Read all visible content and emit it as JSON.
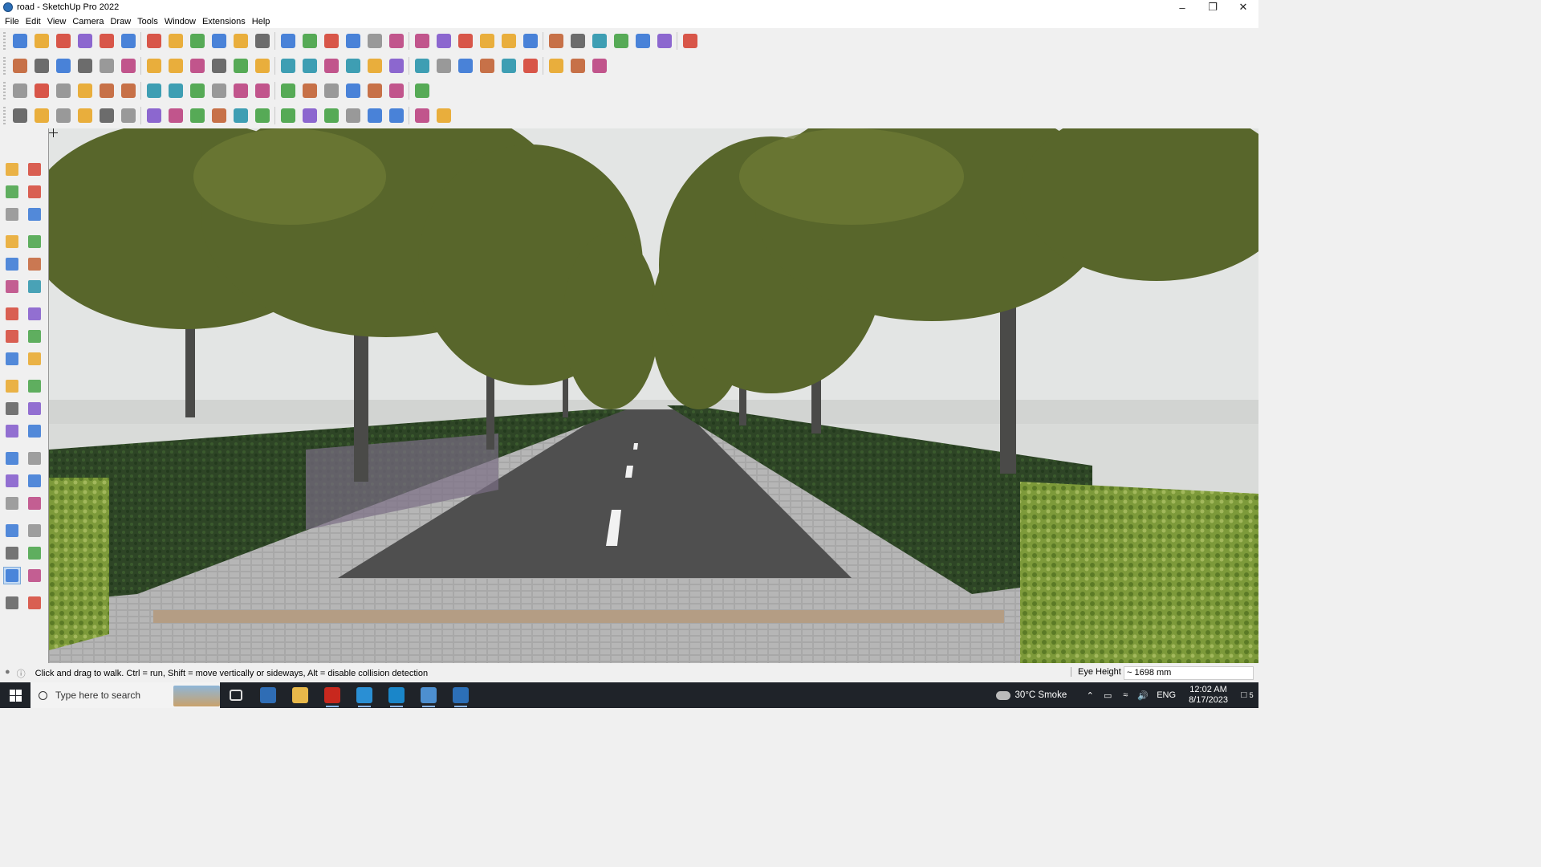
{
  "window": {
    "title": "road - SketchUp Pro 2022",
    "controls": [
      "minimize",
      "restore",
      "close"
    ]
  },
  "menu": [
    "File",
    "Edit",
    "View",
    "Camera",
    "Draw",
    "Tools",
    "Window",
    "Extensions",
    "Help"
  ],
  "toolbars": {
    "row1": [
      "zoom-extents-icon",
      "select-icon",
      "eraser-icon",
      "pencil-line-icon",
      "arc-icon",
      "rectangle-icon",
      "push-pull-icon",
      "follow-me-icon",
      "move-icon",
      "rotate-icon",
      "scale-icon",
      "tape-measure-icon",
      "text-icon",
      "paint-bucket-icon",
      "orbit-icon",
      "pan-icon",
      "zoom-icon",
      "zoom-window-icon",
      "section-plane-icon",
      "display-section-icon",
      "layers-icon",
      "styles-icon",
      "components-icon",
      "warehouse-icon",
      "extension-warehouse-icon",
      "sandbox-icon",
      "drape-icon",
      "flip-icon",
      "intersect-icon",
      "undo-icon",
      "redo-icon"
    ],
    "row2": [
      "iso-view-icon",
      "top-view-icon",
      "front-view-icon",
      "solid-tools-icon",
      "union-icon",
      "subtract-icon",
      "trim-icon",
      "split-icon",
      "outer-shell-icon",
      "intersect-solid-icon",
      "offset-icon",
      "xray-icon",
      "back-edges-icon",
      "wireframe-icon",
      "house-icon",
      "roof-icon",
      "wall-icon",
      "door-icon",
      "window-icon",
      "shape-icon",
      "curve-icon",
      "bezier-icon",
      "polygon-icon",
      "ellipse-icon",
      "arc-tools-icon",
      "spline-icon",
      "fillet-icon"
    ],
    "row3": [
      "face-icon",
      "plane-icon",
      "component-icon",
      "active-component-icon",
      "group-icon",
      "red-cube-icon",
      "chamfer-icon",
      "grid-icon",
      "mesh-icon",
      "profile-icon",
      "curve-select-icon",
      "weld-icon",
      "explode-icon",
      "scale-tool-icon",
      "array-icon",
      "mirror-icon",
      "align-icon",
      "cut-icon",
      "fill-icon"
    ],
    "row4": [
      "line-tool-icon",
      "bezier-tool-icon",
      "material-icon",
      "shape-bender-icon",
      "fredo-scale-icon",
      "joint-push-pull-icon",
      "round-corner-icon",
      "curviloft-icon",
      "skin-icon",
      "extrude-icon",
      "lathe-icon",
      "loft-icon",
      "twist-icon",
      "taper-icon",
      "bend-icon",
      "shear-icon",
      "stretch-icon",
      "spiral-icon",
      "helix-icon",
      "ribbon-icon"
    ]
  },
  "left_toolbar": [
    "select-icon",
    "orbit-icon",
    "paint-bucket-icon",
    "eraser-icon",
    "component-icon",
    "pencil-icon",
    "line-icon",
    "freehand-icon",
    "rectangle-icon",
    "rotated-rectangle-icon",
    "circle-icon",
    "polygon-icon",
    "arc-icon",
    "pie-icon",
    "push-pull-icon",
    "move-icon",
    "rotate-icon",
    "follow-me-icon",
    "scale-icon",
    "offset-icon",
    "tape-measure-icon",
    "dimension-icon",
    "protractor-icon",
    "text-icon",
    "axes-icon",
    "3d-text-icon",
    "orbit2-icon",
    "pan-icon",
    "zoom-icon",
    "zoom-window-icon",
    "zoom-extents-icon",
    "previous-view-icon",
    "position-camera-icon",
    "look-around-icon",
    "walk-icon",
    "section-plane-icon",
    "sandbox-icon",
    "layers-icon"
  ],
  "status": {
    "message": "Click and drag to walk.  Ctrl = run, Shift = move vertically or sideways, Alt = disable collision detection",
    "measure_label": "Eye Height",
    "measure_value": "~ 1698 mm"
  },
  "taskbar": {
    "search_placeholder": "Type here to search",
    "apps": [
      "task-view-icon",
      "calculator-icon",
      "file-explorer-icon",
      "acrobat-icon",
      "sketchup-layout-icon",
      "edge-icon",
      "style-builder-icon",
      "sketchup-icon"
    ],
    "weather": "30°C  Smoke",
    "language": "ENG",
    "time": "12:02 AM",
    "date": "8/17/2023",
    "notification_count": "5"
  },
  "colors": {
    "foliage": "#5c6b2c",
    "hedge": "#2f4a24",
    "road": "#4e4e4e",
    "paving": "#a9a9a9",
    "sky": "#e3e5e4"
  }
}
